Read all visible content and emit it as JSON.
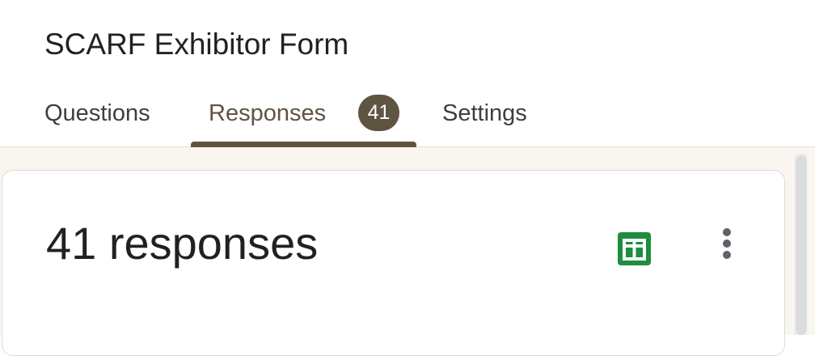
{
  "form": {
    "title": "SCARF Exhibitor Form"
  },
  "tabs": [
    {
      "label": "Questions",
      "active": false
    },
    {
      "label": "Responses",
      "active": true,
      "badge": "41"
    },
    {
      "label": "Settings",
      "active": false
    }
  ],
  "responses": {
    "summary": "41 responses",
    "actions": [
      {
        "icon": "google-sheets-icon",
        "color": "#1e8e3e"
      },
      {
        "icon": "more-vert-icon",
        "color": "#5f6368"
      }
    ]
  },
  "colors": {
    "accent": "#5f5442",
    "page_background": "#f9f6ef"
  }
}
